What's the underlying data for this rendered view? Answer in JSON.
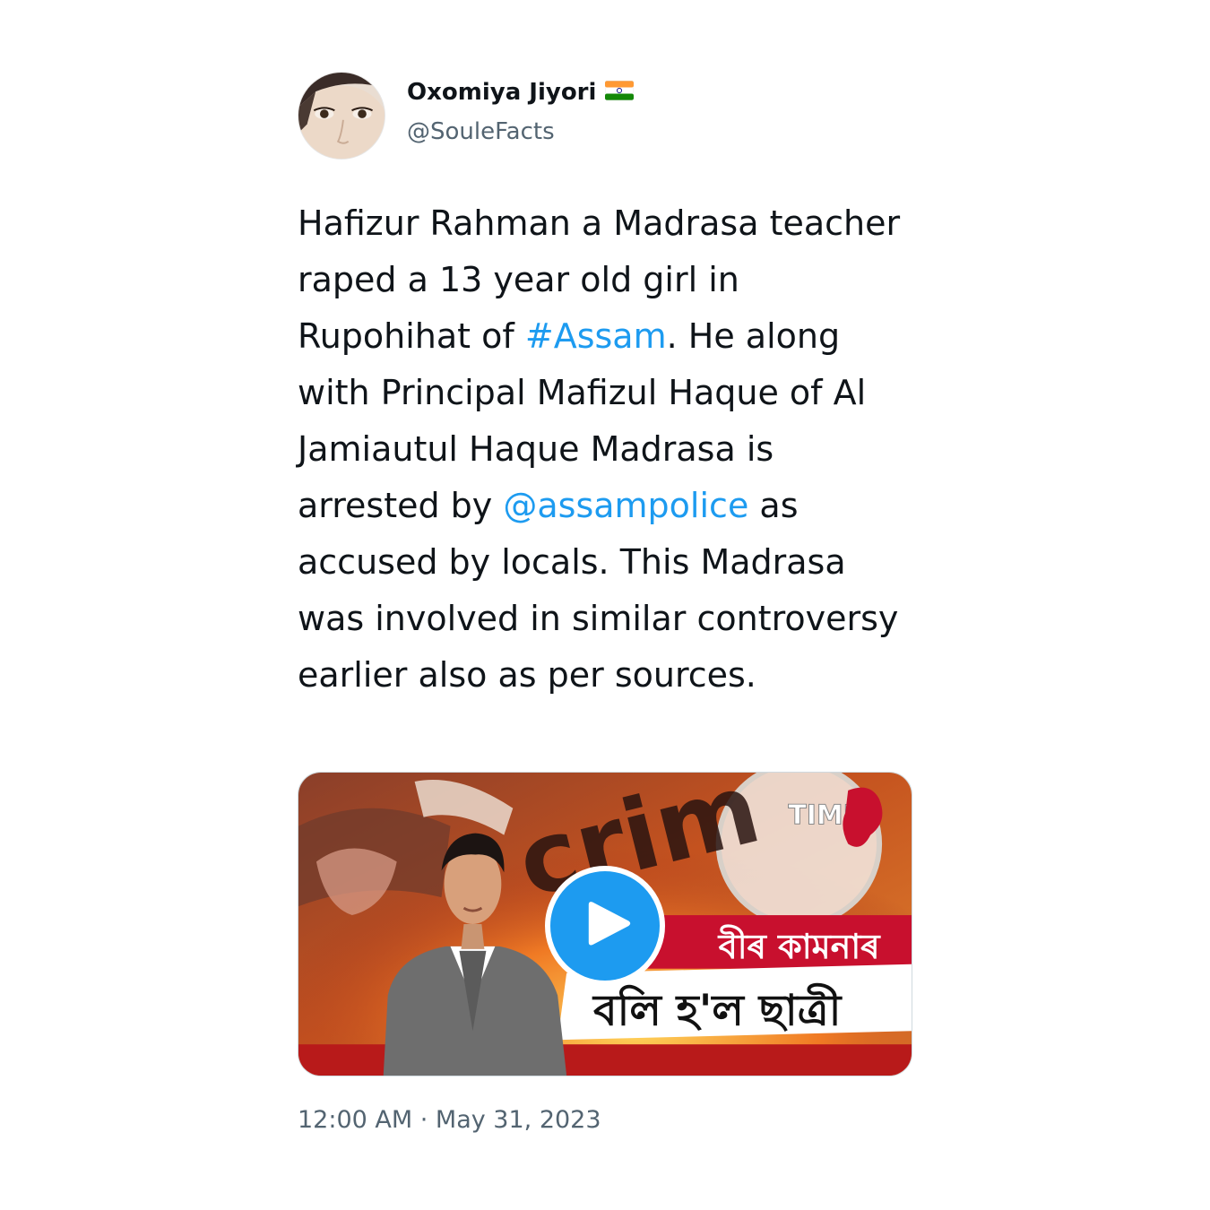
{
  "author": {
    "display_name": "Oxomiya Jiyori",
    "flag_icon": "india-flag-icon",
    "handle": "@SouleFacts"
  },
  "tweet": {
    "text_parts": [
      "Hafizur Rahman a Madrasa teacher raped a 13 year old girl in Rupohihat of ",
      "#Assam",
      ". He along with Principal Mafizul Haque of Al Jamiautul Haque Madrasa is arrested by ",
      "@assampolice",
      " as accused by locals. This Madrasa was involved in similar controversy earlier also as per sources."
    ],
    "link_color": "#1d9bf0"
  },
  "media": {
    "type": "video",
    "play_icon": "play-icon",
    "overlay": {
      "channel_logo": "TIME8",
      "bg_word": "crim",
      "headline_line1": "বীৰ কামনাৰ",
      "headline_line2": "বলি হ'ল ছাত্ৰী"
    },
    "accent_color": "#1d9bf0"
  },
  "timestamp": "12:00 AM · May 31, 2023"
}
